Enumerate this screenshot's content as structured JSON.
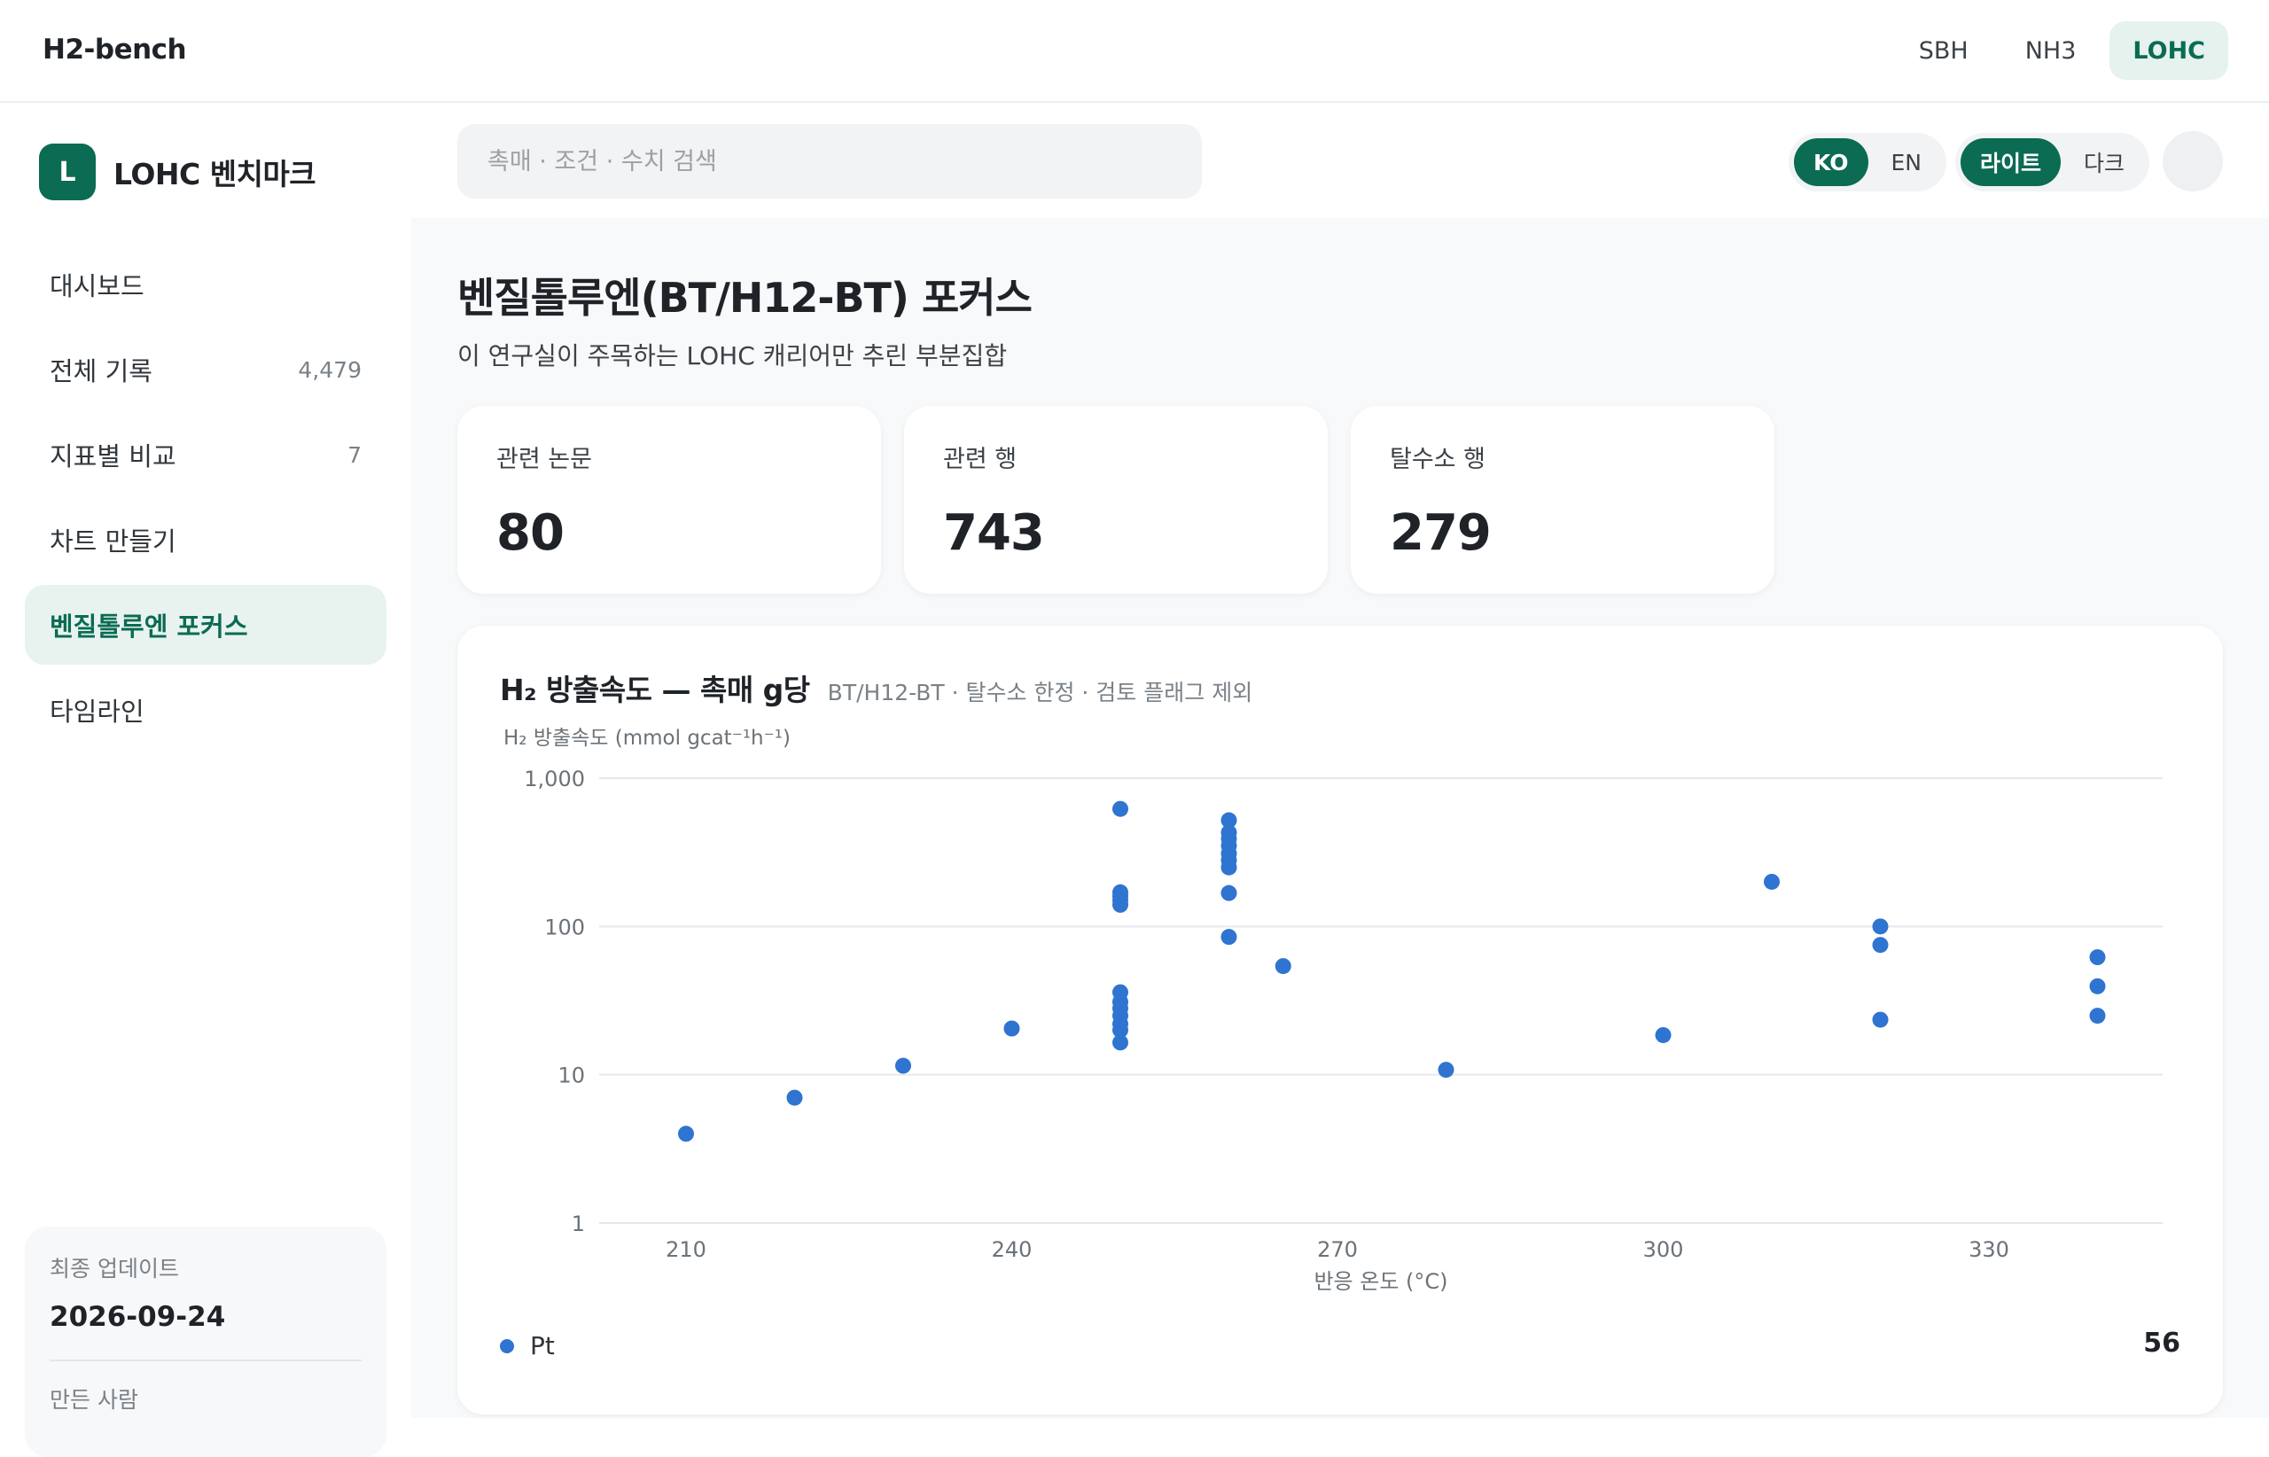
{
  "header": {
    "brand": "H2-bench",
    "nav": [
      {
        "label": "SBH",
        "active": false
      },
      {
        "label": "NH3",
        "active": false
      },
      {
        "label": "LOHC",
        "active": true
      }
    ]
  },
  "sidebar": {
    "logo_letter": "L",
    "title": "LOHC 벤치마크",
    "items": [
      {
        "label": "대시보드",
        "count": ""
      },
      {
        "label": "전체 기록",
        "count": "4,479"
      },
      {
        "label": "지표별 비교",
        "count": "7"
      },
      {
        "label": "차트 만들기",
        "count": ""
      },
      {
        "label": "벤질톨루엔 포커스",
        "count": ""
      },
      {
        "label": "타임라인",
        "count": ""
      }
    ],
    "active_index": 4,
    "footer": {
      "updated_label": "최종 업데이트",
      "updated_value": "2026-09-24",
      "author_label": "만든 사람"
    }
  },
  "search": {
    "placeholder": "촉매 · 조건 · 수치 검색",
    "value": ""
  },
  "lang_toggle": {
    "options": [
      "KO",
      "EN"
    ],
    "selected": "KO"
  },
  "theme_toggle": {
    "options": [
      "라이트",
      "다크"
    ],
    "selected": "라이트"
  },
  "page": {
    "title": "벤질톨루엔(BT/H12-BT) 포커스",
    "subtitle": "이 연구실이 주목하는 LOHC 캐리어만 추린 부분집합"
  },
  "stats": [
    {
      "label": "관련 논문",
      "value": "80"
    },
    {
      "label": "관련 행",
      "value": "743"
    },
    {
      "label": "탈수소 행",
      "value": "279"
    }
  ],
  "chart_card": {
    "title": "H₂ 방출속도 — 촉매 g당",
    "subtitle": "BT/H12-BT · 탈수소 한정 · 검토 플래그 제외",
    "point_count": "56"
  },
  "colors": {
    "accent": "#0b6b53",
    "accent_soft": "#e5f2ee",
    "series": "#2f74d0"
  },
  "chart_data": {
    "type": "scatter",
    "xlabel": "반응 온도 (°C)",
    "ylabel": "H₂ 방출속도 (mmol gcat⁻¹h⁻¹)",
    "xlim": [
      202,
      346
    ],
    "ylim": [
      1,
      1000
    ],
    "yscale": "log",
    "xticks": [
      210,
      240,
      270,
      300,
      330
    ],
    "xtick_labels": [
      "210",
      "240",
      "270",
      "300",
      "330"
    ],
    "yticks": [
      1,
      10,
      100,
      1000
    ],
    "ytick_labels": [
      "1",
      "10",
      "100",
      "1,000"
    ],
    "grid": true,
    "legend_position": "bottom-left",
    "series": [
      {
        "name": "Pt",
        "color": "#2f74d0",
        "points": [
          [
            210,
            4
          ],
          [
            220,
            7
          ],
          [
            230,
            11.5
          ],
          [
            240,
            20.5
          ],
          [
            250,
            620
          ],
          [
            250,
            170
          ],
          [
            250,
            160
          ],
          [
            250,
            150
          ],
          [
            250,
            140
          ],
          [
            250,
            36
          ],
          [
            250,
            31
          ],
          [
            250,
            28
          ],
          [
            250,
            25
          ],
          [
            250,
            22
          ],
          [
            250,
            20
          ],
          [
            250,
            16.5
          ],
          [
            260,
            520
          ],
          [
            260,
            430
          ],
          [
            260,
            390
          ],
          [
            260,
            350
          ],
          [
            260,
            310
          ],
          [
            260,
            280
          ],
          [
            260,
            250
          ],
          [
            260,
            168
          ],
          [
            260,
            85
          ],
          [
            265,
            54
          ],
          [
            280,
            10.8
          ],
          [
            300,
            18.5
          ],
          [
            310,
            200
          ],
          [
            320,
            100
          ],
          [
            320,
            75
          ],
          [
            320,
            23.5
          ],
          [
            340,
            62
          ],
          [
            340,
            39.5
          ],
          [
            340,
            25
          ]
        ]
      }
    ]
  }
}
